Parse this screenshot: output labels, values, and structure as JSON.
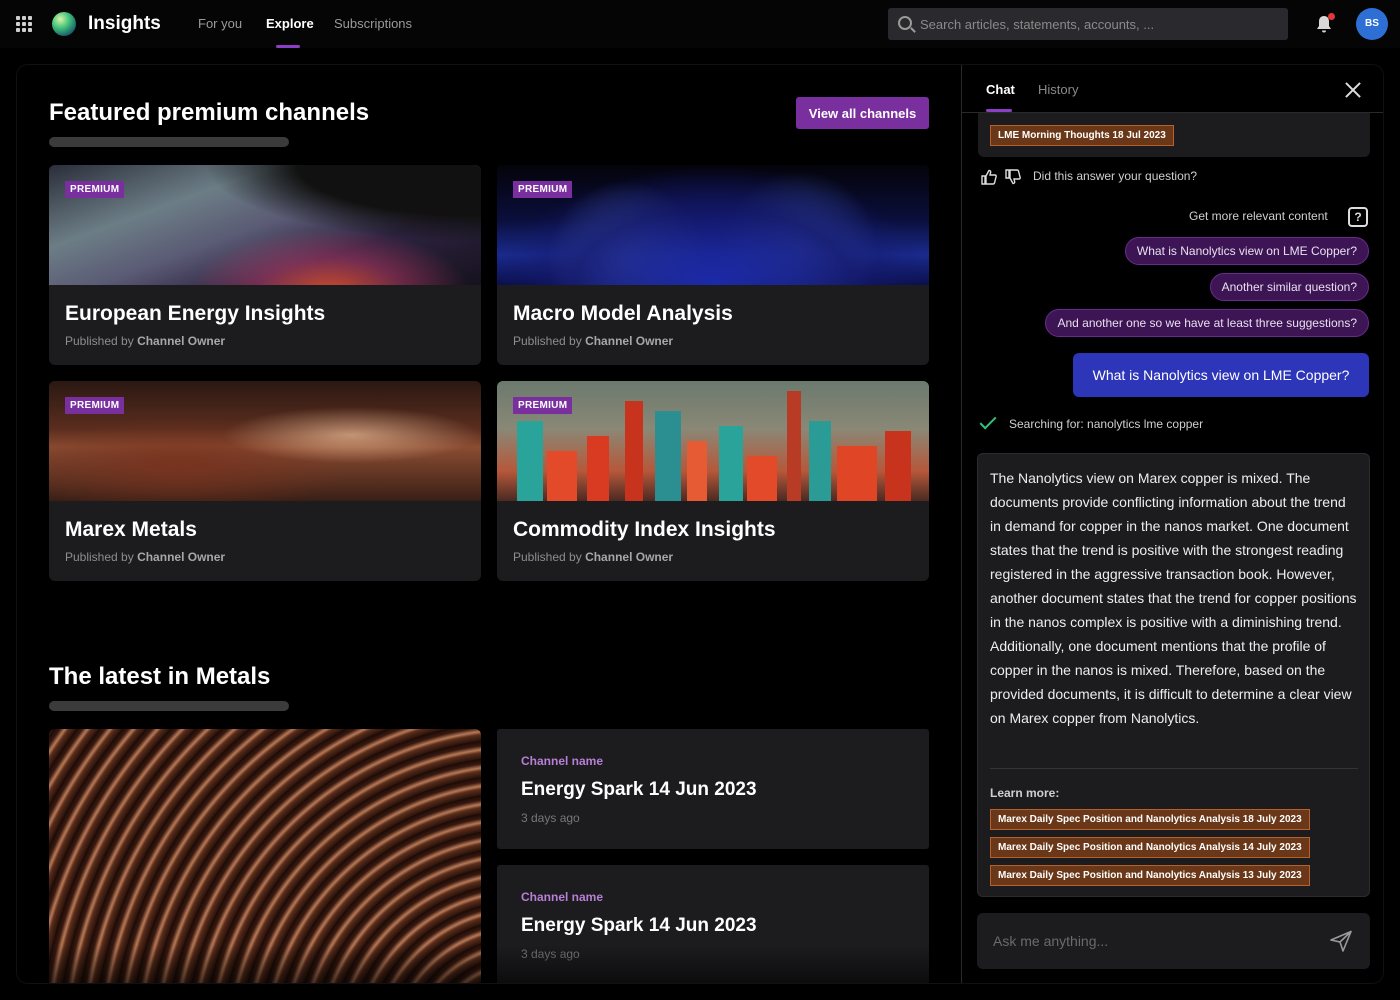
{
  "app": {
    "title": "Insights"
  },
  "nav": {
    "tabs": [
      {
        "label": "For you"
      },
      {
        "label": "Explore"
      },
      {
        "label": "Subscriptions"
      }
    ],
    "active": "Explore"
  },
  "search": {
    "placeholder": "Search articles, statements, accounts, ..."
  },
  "user": {
    "initials": "BS"
  },
  "featured": {
    "title": "Featured premium channels",
    "view_all_label": "View all channels",
    "published_prefix": "Published by",
    "cards": [
      {
        "badge": "PREMIUM",
        "title": "European Energy Insights",
        "owner": "Channel Owner"
      },
      {
        "badge": "PREMIUM",
        "title": "Macro Model Analysis",
        "owner": "Channel Owner"
      },
      {
        "badge": "PREMIUM",
        "title": "Marex Metals",
        "owner": "Channel Owner"
      },
      {
        "badge": "PREMIUM",
        "title": "Commodity Index Insights",
        "owner": "Channel Owner"
      }
    ]
  },
  "latest": {
    "title": "The latest in Metals",
    "articles": [
      {
        "channel": "Channel name",
        "title": "Energy Spark 14 Jun 2023",
        "time": "3 days ago"
      },
      {
        "channel": "Channel name",
        "title": "Energy Spark 14 Jun 2023",
        "time": "3 days ago"
      }
    ]
  },
  "chat": {
    "tabs": [
      {
        "label": "Chat"
      },
      {
        "label": "History"
      }
    ],
    "active_tab": "Chat",
    "previous_sources": [
      "LME Morning Thoughts 18 Jul 2023"
    ],
    "feedback_question": "Did this answer your question?",
    "more_content_label": "Get more relevant content",
    "help_glyph": "?",
    "suggestions": [
      "What is Nanolytics view on LME Copper?",
      "Another similar question?",
      "And another one so we have at least three suggestions?"
    ],
    "user_message": "What is Nanolytics view on LME Copper?",
    "searching_status": "Searching for: nanolytics lme copper",
    "answer": "The Nanolytics view on Marex copper is mixed. The documents provide conflicting information about the trend in demand for copper in the nanos market. One document states that the trend is positive with the strongest reading registered in the aggressive transaction book. However, another document states that the trend for copper positions in the nanos complex is positive with a diminishing trend. Additionally, one document mentions that the profile of copper in the nanos is mixed. Therefore, based on the provided documents, it is difficult to determine a clear view on Marex copper from Nanolytics.",
    "learn_more_label": "Learn more:",
    "sources": [
      "Marex Daily Spec Position and Nanolytics Analysis 18 July 2023",
      "Marex Daily Spec Position and Nanolytics Analysis 14 July 2023",
      "Marex Daily Spec Position and Nanolytics Analysis 13 July 2023"
    ],
    "input_placeholder": "Ask me anything..."
  },
  "colors": {
    "accent": "#7a2f9e",
    "user_bubble": "#2d35b8",
    "suggestion": "#3d1555",
    "source_tag": "#6a3818",
    "success": "#34c27a"
  }
}
